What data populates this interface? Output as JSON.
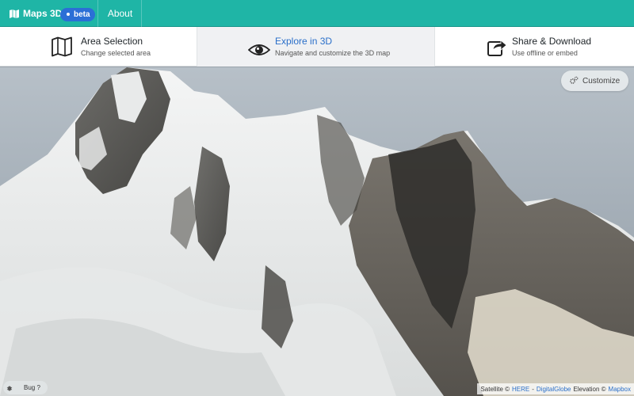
{
  "header": {
    "brand": "Maps 3D",
    "badge": "beta",
    "about": "About",
    "accent_color": "#1fb5a6"
  },
  "steps": [
    {
      "title": "Area Selection",
      "subtitle": "Change selected area",
      "icon": "map-icon"
    },
    {
      "title": "Explore in 3D",
      "subtitle": "Navigate and customize the 3D map",
      "icon": "eye-icon",
      "active": true
    },
    {
      "title": "Share & Download",
      "subtitle": "Use offline or embed",
      "icon": "share-icon"
    }
  ],
  "map": {
    "customize_label": "Customize",
    "bug_label": "Bug ?",
    "attribution": {
      "satellite_prefix": "Satellite ©",
      "satellite_link1": "HERE",
      "separator": "-",
      "satellite_link2": "DigitalGlobe",
      "elevation_prefix": "Elevation ©",
      "elevation_link": "Mapbox"
    }
  }
}
